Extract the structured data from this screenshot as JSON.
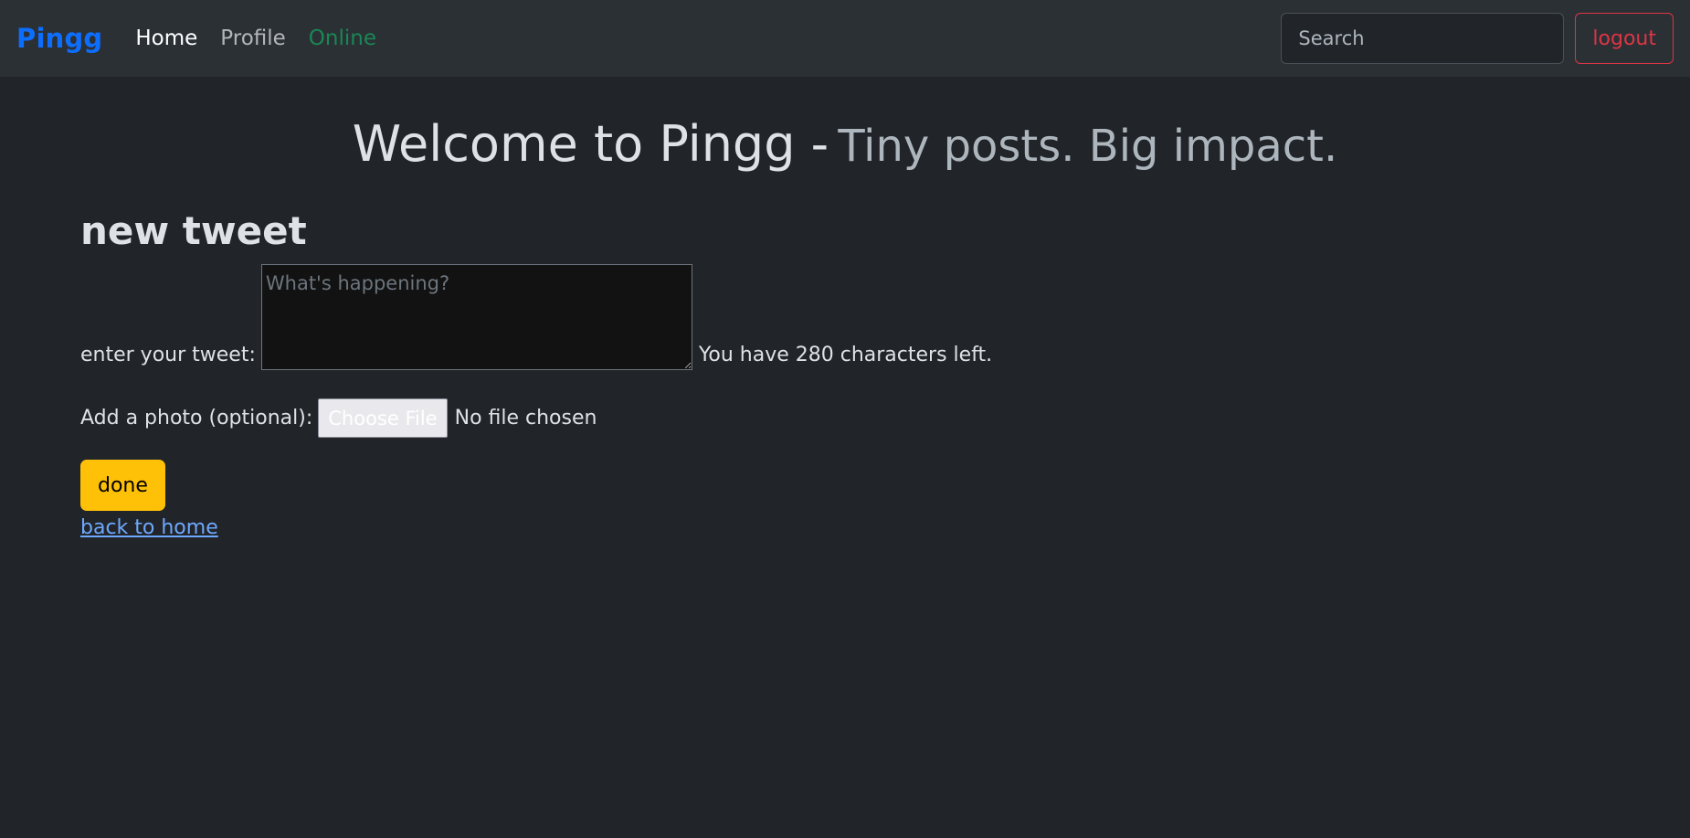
{
  "navbar": {
    "brand": "Pingg",
    "links": [
      {
        "label": "Home"
      },
      {
        "label": "Profile"
      },
      {
        "label": "Online"
      }
    ],
    "search_placeholder": "Search",
    "logout_label": "logout"
  },
  "header": {
    "title": "Welcome to Pingg -",
    "tagline": "Tiny posts. Big impact."
  },
  "form": {
    "section_title": "new tweet",
    "tweet_label": "enter your tweet:",
    "tweet_placeholder": "What's happening?",
    "char_count_text": "You have 280 characters left.",
    "photo_label": "Add a photo (optional):",
    "file_button_label": "Choose File",
    "file_status": "No file chosen",
    "submit_label": "done",
    "back_link_label": "back to home"
  },
  "colors": {
    "background": "#212529",
    "navbar_bg": "#2b3035",
    "brand": "#0d6efd",
    "online": "#198754",
    "logout": "#dc3545",
    "submit": "#ffc107",
    "link": "#6ea8fe"
  }
}
